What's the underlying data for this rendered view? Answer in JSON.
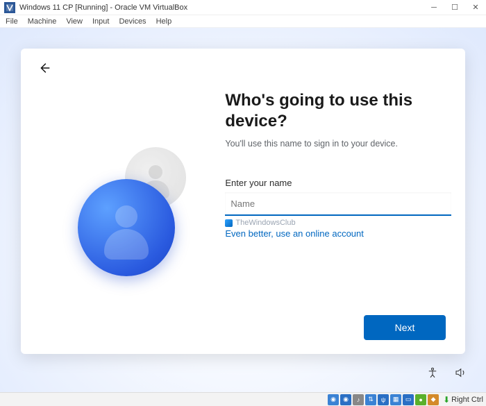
{
  "virtualbox": {
    "title": "Windows 11 CP [Running] - Oracle VM VirtualBox",
    "menu": {
      "file": "File",
      "machine": "Machine",
      "view": "View",
      "input": "Input",
      "devices": "Devices",
      "help": "Help"
    },
    "host_key": "Right Ctrl"
  },
  "oobe": {
    "heading": "Who's going to use this device?",
    "sub": "You'll use this name to sign in to your device.",
    "field_label": "Enter your name",
    "name_placeholder": "Name",
    "name_value": "",
    "watermark": "TheWindowsClub",
    "online_link": "Even better, use an online account",
    "next": "Next"
  }
}
